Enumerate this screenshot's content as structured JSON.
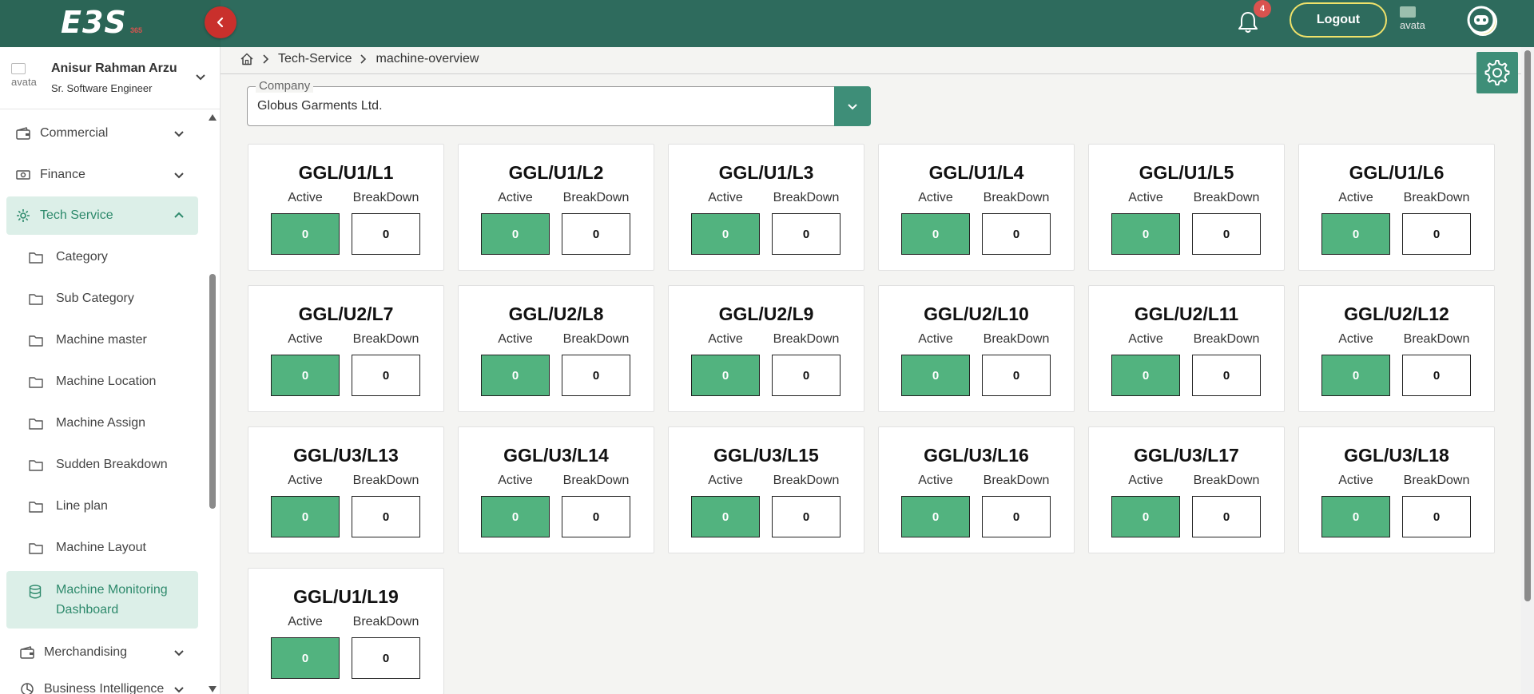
{
  "header": {
    "logo_text": "E3S",
    "logo_sub": "365",
    "notification_count": "4",
    "logout_label": "Logout",
    "avatar_alt": "avata"
  },
  "user": {
    "avatar_alt": "avata",
    "name": "Anisur Rahman Arzu",
    "role": "Sr. Software Engineer"
  },
  "sidebar": {
    "menus": [
      {
        "label": "Commercial",
        "icon": "wallet-icon"
      },
      {
        "label": "Finance",
        "icon": "cash-icon"
      },
      {
        "label": "Tech Service",
        "icon": "gear-icon"
      },
      {
        "label": "Merchandising",
        "icon": "wallet-icon"
      },
      {
        "label": "Business Intelligence",
        "icon": "chart-icon"
      }
    ],
    "sub_items": [
      {
        "label": "Category"
      },
      {
        "label": "Sub Category"
      },
      {
        "label": "Machine master"
      },
      {
        "label": "Machine Location"
      },
      {
        "label": "Machine Assign"
      },
      {
        "label": "Sudden Breakdown"
      },
      {
        "label": "Line plan"
      },
      {
        "label": "Machine Layout"
      },
      {
        "label": "Machine Monitoring Dashboard"
      }
    ]
  },
  "breadcrumb": {
    "items": [
      "Tech-Service",
      "machine-overview"
    ]
  },
  "company": {
    "label": "Company",
    "value": "Globus Garments Ltd."
  },
  "cards": {
    "active_label": "Active",
    "breakdown_label": "BreakDown",
    "items": [
      {
        "title": "GGL/U1/L1",
        "active": "0",
        "breakdown": "0"
      },
      {
        "title": "GGL/U1/L2",
        "active": "0",
        "breakdown": "0"
      },
      {
        "title": "GGL/U1/L3",
        "active": "0",
        "breakdown": "0"
      },
      {
        "title": "GGL/U1/L4",
        "active": "0",
        "breakdown": "0"
      },
      {
        "title": "GGL/U1/L5",
        "active": "0",
        "breakdown": "0"
      },
      {
        "title": "GGL/U1/L6",
        "active": "0",
        "breakdown": "0"
      },
      {
        "title": "GGL/U2/L7",
        "active": "0",
        "breakdown": "0"
      },
      {
        "title": "GGL/U2/L8",
        "active": "0",
        "breakdown": "0"
      },
      {
        "title": "GGL/U2/L9",
        "active": "0",
        "breakdown": "0"
      },
      {
        "title": "GGL/U2/L10",
        "active": "0",
        "breakdown": "0"
      },
      {
        "title": "GGL/U2/L11",
        "active": "0",
        "breakdown": "0"
      },
      {
        "title": "GGL/U2/L12",
        "active": "0",
        "breakdown": "0"
      },
      {
        "title": "GGL/U3/L13",
        "active": "0",
        "breakdown": "0"
      },
      {
        "title": "GGL/U3/L14",
        "active": "0",
        "breakdown": "0"
      },
      {
        "title": "GGL/U3/L15",
        "active": "0",
        "breakdown": "0"
      },
      {
        "title": "GGL/U3/L16",
        "active": "0",
        "breakdown": "0"
      },
      {
        "title": "GGL/U3/L17",
        "active": "0",
        "breakdown": "0"
      },
      {
        "title": "GGL/U3/L18",
        "active": "0",
        "breakdown": "0"
      },
      {
        "title": "GGL/U1/L19",
        "active": "0",
        "breakdown": "0"
      }
    ]
  },
  "colors": {
    "header_bg": "#2e6b5d",
    "accent": "#3e8e78",
    "active_box": "#52b37f",
    "collapse_button": "#c9302c",
    "badge": "#d9534f"
  }
}
